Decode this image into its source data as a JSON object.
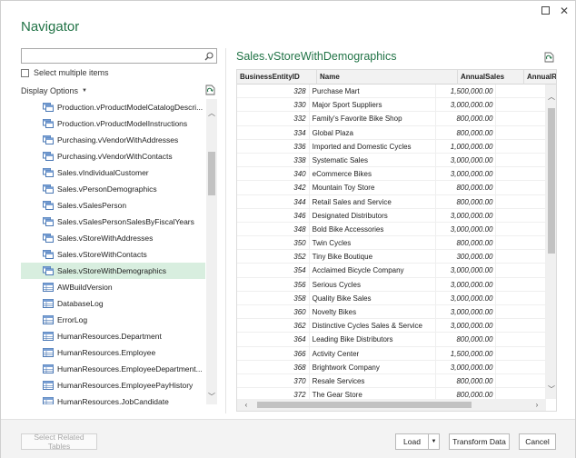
{
  "window": {
    "title": "Navigator",
    "maximize_icon": "maximize-icon",
    "close_glyph": "✕"
  },
  "left_pane": {
    "search": {
      "value": "",
      "placeholder": ""
    },
    "select_multiple_label": "Select multiple items",
    "select_multiple_checked": false,
    "display_options_label": "Display Options",
    "tree_items": [
      {
        "label": "Production.vProductModelCatalogDescri...",
        "icon": "view-icon",
        "selected": false
      },
      {
        "label": "Production.vProductModelInstructions",
        "icon": "view-icon",
        "selected": false
      },
      {
        "label": "Purchasing.vVendorWithAddresses",
        "icon": "view-icon",
        "selected": false
      },
      {
        "label": "Purchasing.vVendorWithContacts",
        "icon": "view-icon",
        "selected": false
      },
      {
        "label": "Sales.vIndividualCustomer",
        "icon": "view-icon",
        "selected": false
      },
      {
        "label": "Sales.vPersonDemographics",
        "icon": "view-icon",
        "selected": false
      },
      {
        "label": "Sales.vSalesPerson",
        "icon": "view-icon",
        "selected": false
      },
      {
        "label": "Sales.vSalesPersonSalesByFiscalYears",
        "icon": "view-icon",
        "selected": false
      },
      {
        "label": "Sales.vStoreWithAddresses",
        "icon": "view-icon",
        "selected": false
      },
      {
        "label": "Sales.vStoreWithContacts",
        "icon": "view-icon",
        "selected": false
      },
      {
        "label": "Sales.vStoreWithDemographics",
        "icon": "view-icon",
        "selected": true
      },
      {
        "label": "AWBuildVersion",
        "icon": "table-icon",
        "selected": false
      },
      {
        "label": "DatabaseLog",
        "icon": "table-icon",
        "selected": false
      },
      {
        "label": "ErrorLog",
        "icon": "table-icon",
        "selected": false
      },
      {
        "label": "HumanResources.Department",
        "icon": "table-icon",
        "selected": false
      },
      {
        "label": "HumanResources.Employee",
        "icon": "table-icon",
        "selected": false
      },
      {
        "label": "HumanResources.EmployeeDepartment...",
        "icon": "table-icon",
        "selected": false
      },
      {
        "label": "HumanResources.EmployeePayHistory",
        "icon": "table-icon",
        "selected": false
      },
      {
        "label": "HumanResources.JobCandidate",
        "icon": "table-icon",
        "selected": false
      }
    ]
  },
  "preview": {
    "title": "Sales.vStoreWithDemographics",
    "columns": [
      "BusinessEntityID",
      "Name",
      "AnnualSales",
      "AnnualRev"
    ],
    "rows": [
      [
        "328",
        "Purchase Mart",
        "1,500,000.00"
      ],
      [
        "330",
        "Major Sport Suppliers",
        "3,000,000.00"
      ],
      [
        "332",
        "Family's Favorite Bike Shop",
        "800,000.00"
      ],
      [
        "334",
        "Global Plaza",
        "800,000.00"
      ],
      [
        "336",
        "Imported and Domestic Cycles",
        "1,000,000.00"
      ],
      [
        "338",
        "Systematic Sales",
        "3,000,000.00"
      ],
      [
        "340",
        "eCommerce Bikes",
        "3,000,000.00"
      ],
      [
        "342",
        "Mountain Toy Store",
        "800,000.00"
      ],
      [
        "344",
        "Retail Sales and Service",
        "800,000.00"
      ],
      [
        "346",
        "Designated Distributors",
        "3,000,000.00"
      ],
      [
        "348",
        "Bold Bike Accessories",
        "3,000,000.00"
      ],
      [
        "350",
        "Twin Cycles",
        "800,000.00"
      ],
      [
        "352",
        "Tiny Bike Boutique",
        "300,000.00"
      ],
      [
        "354",
        "Acclaimed Bicycle Company",
        "3,000,000.00"
      ],
      [
        "356",
        "Serious Cycles",
        "3,000,000.00"
      ],
      [
        "358",
        "Quality Bike Sales",
        "3,000,000.00"
      ],
      [
        "360",
        "Novelty Bikes",
        "3,000,000.00"
      ],
      [
        "362",
        "Distinctive Cycles Sales & Service",
        "3,000,000.00"
      ],
      [
        "364",
        "Leading Bike Distributors",
        "800,000.00"
      ],
      [
        "366",
        "Activity Center",
        "1,500,000.00"
      ],
      [
        "368",
        "Brightwork Company",
        "3,000,000.00"
      ],
      [
        "370",
        "Resale Services",
        "800,000.00"
      ],
      [
        "372",
        "The Gear Store",
        "800,000.00"
      ]
    ]
  },
  "footer": {
    "select_related_label": "Select Related Tables",
    "load_label": "Load",
    "transform_label": "Transform Data",
    "cancel_label": "Cancel"
  },
  "colors": {
    "accent": "#217346",
    "selection": "#d8eedf"
  }
}
